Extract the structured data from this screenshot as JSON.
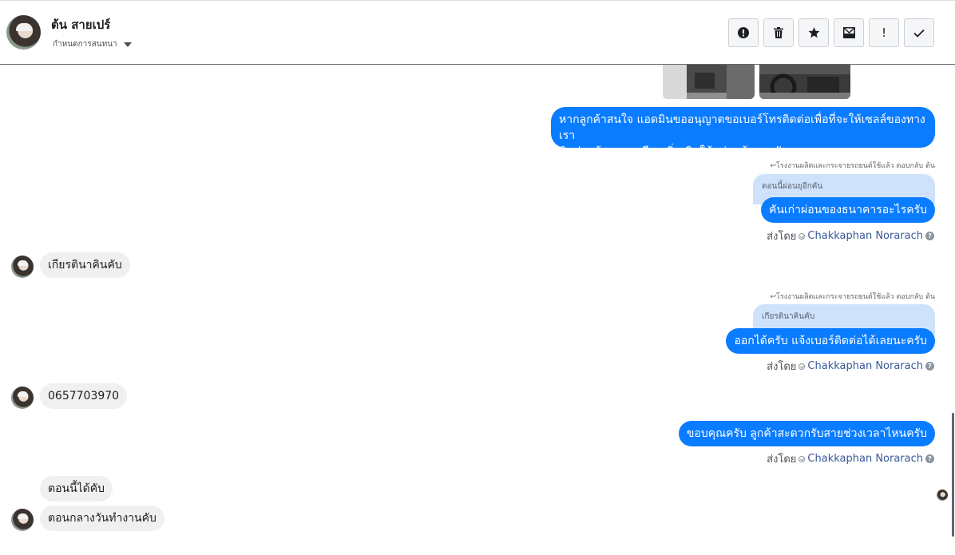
{
  "header": {
    "contact_name": "ต้น สายเปร์",
    "subtitle": "กำหนดการสนทนา",
    "toolbar": {
      "spam": "!",
      "delete": "trash",
      "star": "star",
      "unread": "envelope",
      "important": "!",
      "done": "check"
    }
  },
  "messages": [
    {
      "id": "m1",
      "direction": "outgoing",
      "text_line1": "หากลูกค้าสนใจ แอดมินขออนุญาตขอเบอร์โทรติดต่อเพื่อที่จะให้เซลล์ของทางเรา",
      "text_line2": "ติดต่อแจ้งรายละเอียดเพิ่มเติมให้แก่ลูกค้านะครับ"
    },
    {
      "id": "m2",
      "direction": "outgoing",
      "reply_label": "โรงงานผลิตและกระจายรถยนต์ใช้แล้ว ตอบกลับ ต้น",
      "quoted": "ตอนนี้ผ่อนยุอีกคัน",
      "text": "คันเก่าผ่อนของธนาคารอะไรครับ",
      "sent_by_label": "ส่งโดย",
      "agent": "Chakkaphan Norarach"
    },
    {
      "id": "m3",
      "direction": "incoming",
      "text": "เกียรตินาคินคับ"
    },
    {
      "id": "m4",
      "direction": "outgoing",
      "reply_label": "โรงงานผลิตและกระจายรถยนต์ใช้แล้ว ตอบกลับ ต้น",
      "quoted": "เกียรตินาคินคับ",
      "text": "ออกได้ครับ แจ้งเบอร์ติดต่อได้เลยนะครับ",
      "sent_by_label": "ส่งโดย",
      "agent": "Chakkaphan Norarach"
    },
    {
      "id": "m5",
      "direction": "incoming",
      "text": "0657703970"
    },
    {
      "id": "m6",
      "direction": "outgoing",
      "text": "ขอบคุณครับ ลูกค้าสะดวกรับสายช่วงเวลาไหนครับ",
      "sent_by_label": "ส่งโดย",
      "agent": "Chakkaphan Norarach"
    },
    {
      "id": "m7",
      "direction": "incoming",
      "text": "ตอนนี้ได้คับ"
    },
    {
      "id": "m8",
      "direction": "incoming",
      "text": "ตอนกลางวันทำงานคับ"
    }
  ],
  "icons": {
    "avatar": "user-avatar",
    "verified": "check-circle-icon",
    "help": "question-icon"
  },
  "colors": {
    "outgoing_bubble": "#0a7cff",
    "incoming_bubble": "#f0f0f0",
    "quoted_bubble": "#cfe2fc",
    "agent_link": "#385898"
  }
}
